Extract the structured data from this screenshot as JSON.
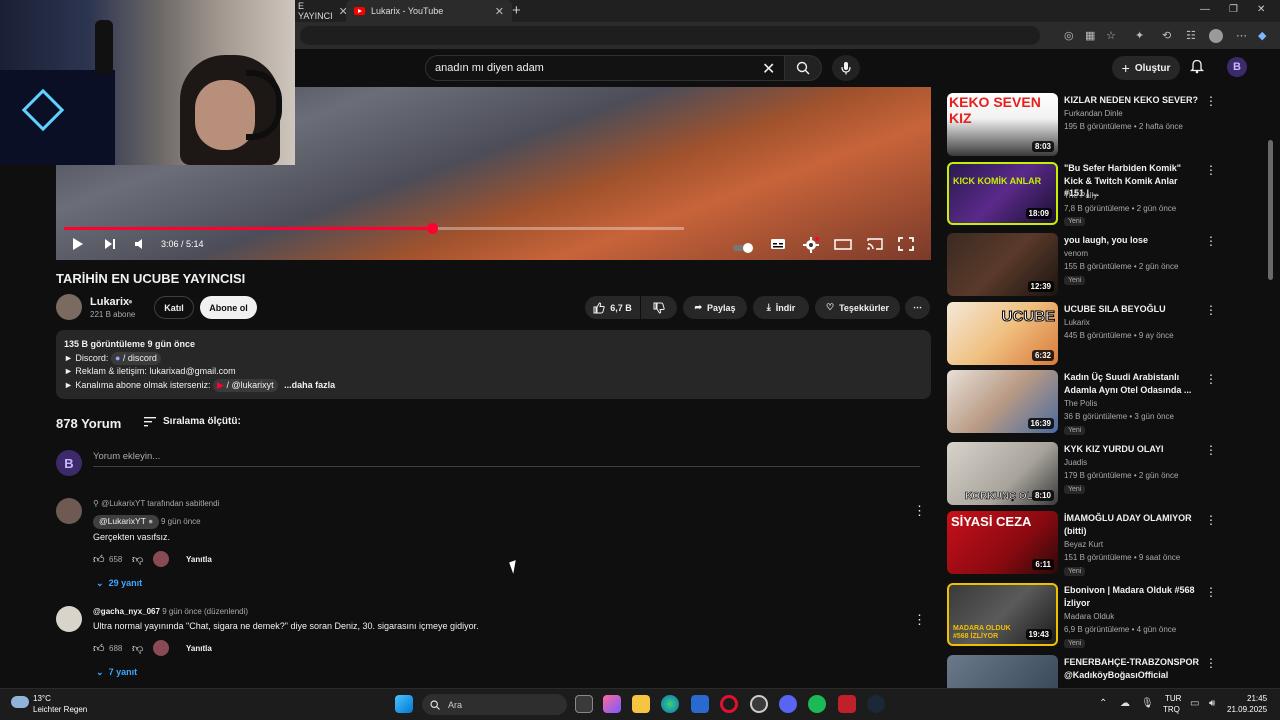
{
  "browser": {
    "tabs": [
      {
        "label": "E YAYINCI"
      },
      {
        "label": "Lukarix - YouTube"
      }
    ]
  },
  "header": {
    "search_value": "anadın mı diyen adam",
    "create_label": "Oluştur"
  },
  "player": {
    "time": "3:06 / 5:14",
    "progress_fraction": 0.593
  },
  "video": {
    "title": "TARİHİN EN UCUBE YAYINCISI",
    "channel": "Lukarix",
    "subscribers": "221 B abone",
    "join_label": "Katıl",
    "subscribe_label": "Abone ol",
    "likes": "6,7 B",
    "share_label": "Paylaş",
    "download_label": "İndir",
    "thanks_label": "Teşekkürler"
  },
  "description": {
    "meta": "135 B görüntüleme  9 gün önce",
    "line1_prefix": "► Discord:",
    "line1_chip": "/ discord",
    "line2": "► Reklam & iletişim: lukarixad@gmail.com",
    "line3_prefix": "► Kanalıma abone olmak isterseniz:",
    "line3_chip": "/ @lukarixyt",
    "more": "...daha fazla"
  },
  "comments_header": {
    "count": "878 Yorum",
    "sort_label": "Sıralama ölçütü:",
    "placeholder": "Yorum ekleyin..."
  },
  "comments": [
    {
      "pinned": "@LukarixYT tarafından sabitlendi",
      "author": "@LukarixYT",
      "time": "9 gün önce",
      "text": "Gerçekten vasıfsız.",
      "likes": "658",
      "reply_label": "Yanıtla",
      "replies": "29 yanıt"
    },
    {
      "author": "@gacha_nyx_067",
      "time": "9 gün önce (düzenlendi)",
      "text": "Ultra normal yayınında \"Chat, sigara ne demek?\" diye soran Deniz, 30. sigarasını içmeye gidiyor.",
      "likes": "688",
      "reply_label": "Yanıtla",
      "replies": "7 yanıt"
    }
  ],
  "sidebar": [
    {
      "title": "KIZLAR NEDEN KEKO SEVER?",
      "channel": "Furkandan Dinle",
      "meta": "195 B görüntüleme • 2 hafta önce",
      "duration": "8:03",
      "thumb_text": "KEKO SEVEN KIZ",
      "new": ""
    },
    {
      "title": "\"Bu Sefer Harbiden Komik\" Kick & Twitch Komik Anlar #151 | ...",
      "channel": "The Pally",
      "meta": "7,8 B görüntüleme • 2 gün önce",
      "duration": "18:09",
      "thumb_text": "KICK KOMİK ANLAR",
      "new": "Yeni"
    },
    {
      "title": "you laugh, you lose",
      "channel": "venom",
      "meta": "155 B görüntüleme • 2 gün önce",
      "duration": "12:39",
      "thumb_text": "",
      "new": "Yeni"
    },
    {
      "title": "UCUBE SILA BEYOĞLU",
      "channel": "Lukarix",
      "meta": "445 B görüntüleme • 9 ay önce",
      "duration": "6:32",
      "thumb_text": "UCUBE",
      "new": ""
    },
    {
      "title": "Kadın Üç Suudi Arabistanlı Adamla Aynı Otel Odasında ...",
      "channel": "The Polis",
      "meta": "36 B görüntüleme • 3 gün önce",
      "duration": "16:39",
      "thumb_text": "",
      "new": "Yeni"
    },
    {
      "title": "KYK KIZ YURDU OLAYI",
      "channel": "Juadis",
      "meta": "179 B görüntüleme • 2 gün önce",
      "duration": "8:10",
      "thumb_text": "KORKUNÇ OLAY",
      "new": "Yeni"
    },
    {
      "title": "İMAMOĞLU ADAY OLAMIYOR (bitti)",
      "channel": "Beyaz Kurt",
      "meta": "151 B görüntüleme • 9 saat önce",
      "duration": "6:11",
      "thumb_text": "SİYASİ CEZA",
      "new": "Yeni"
    },
    {
      "title": "Ebonivon | Madara Olduk #568 İzliyor",
      "channel": "Madara Olduk",
      "meta": "6,9 B görüntüleme • 4 gün önce",
      "duration": "19:43",
      "thumb_text": "MADARA OLDUK #568 İZLİYOR",
      "new": "Yeni"
    },
    {
      "title": "FENERBAHÇE-TRABZONSPOR @KadıköyBoğasıOfficial",
      "channel": "",
      "meta": "",
      "duration": "",
      "thumb_text": "",
      "new": ""
    }
  ],
  "taskbar": {
    "temp": "13°C",
    "weather": "Leichter Regen",
    "search": "Ara",
    "lang1": "TUR",
    "lang2": "TRQ",
    "time": "21:45",
    "date": "21.09.2025"
  },
  "colors": {
    "accent": "#ff0033",
    "link": "#3ea6ff",
    "background": "#0f0f0f"
  }
}
